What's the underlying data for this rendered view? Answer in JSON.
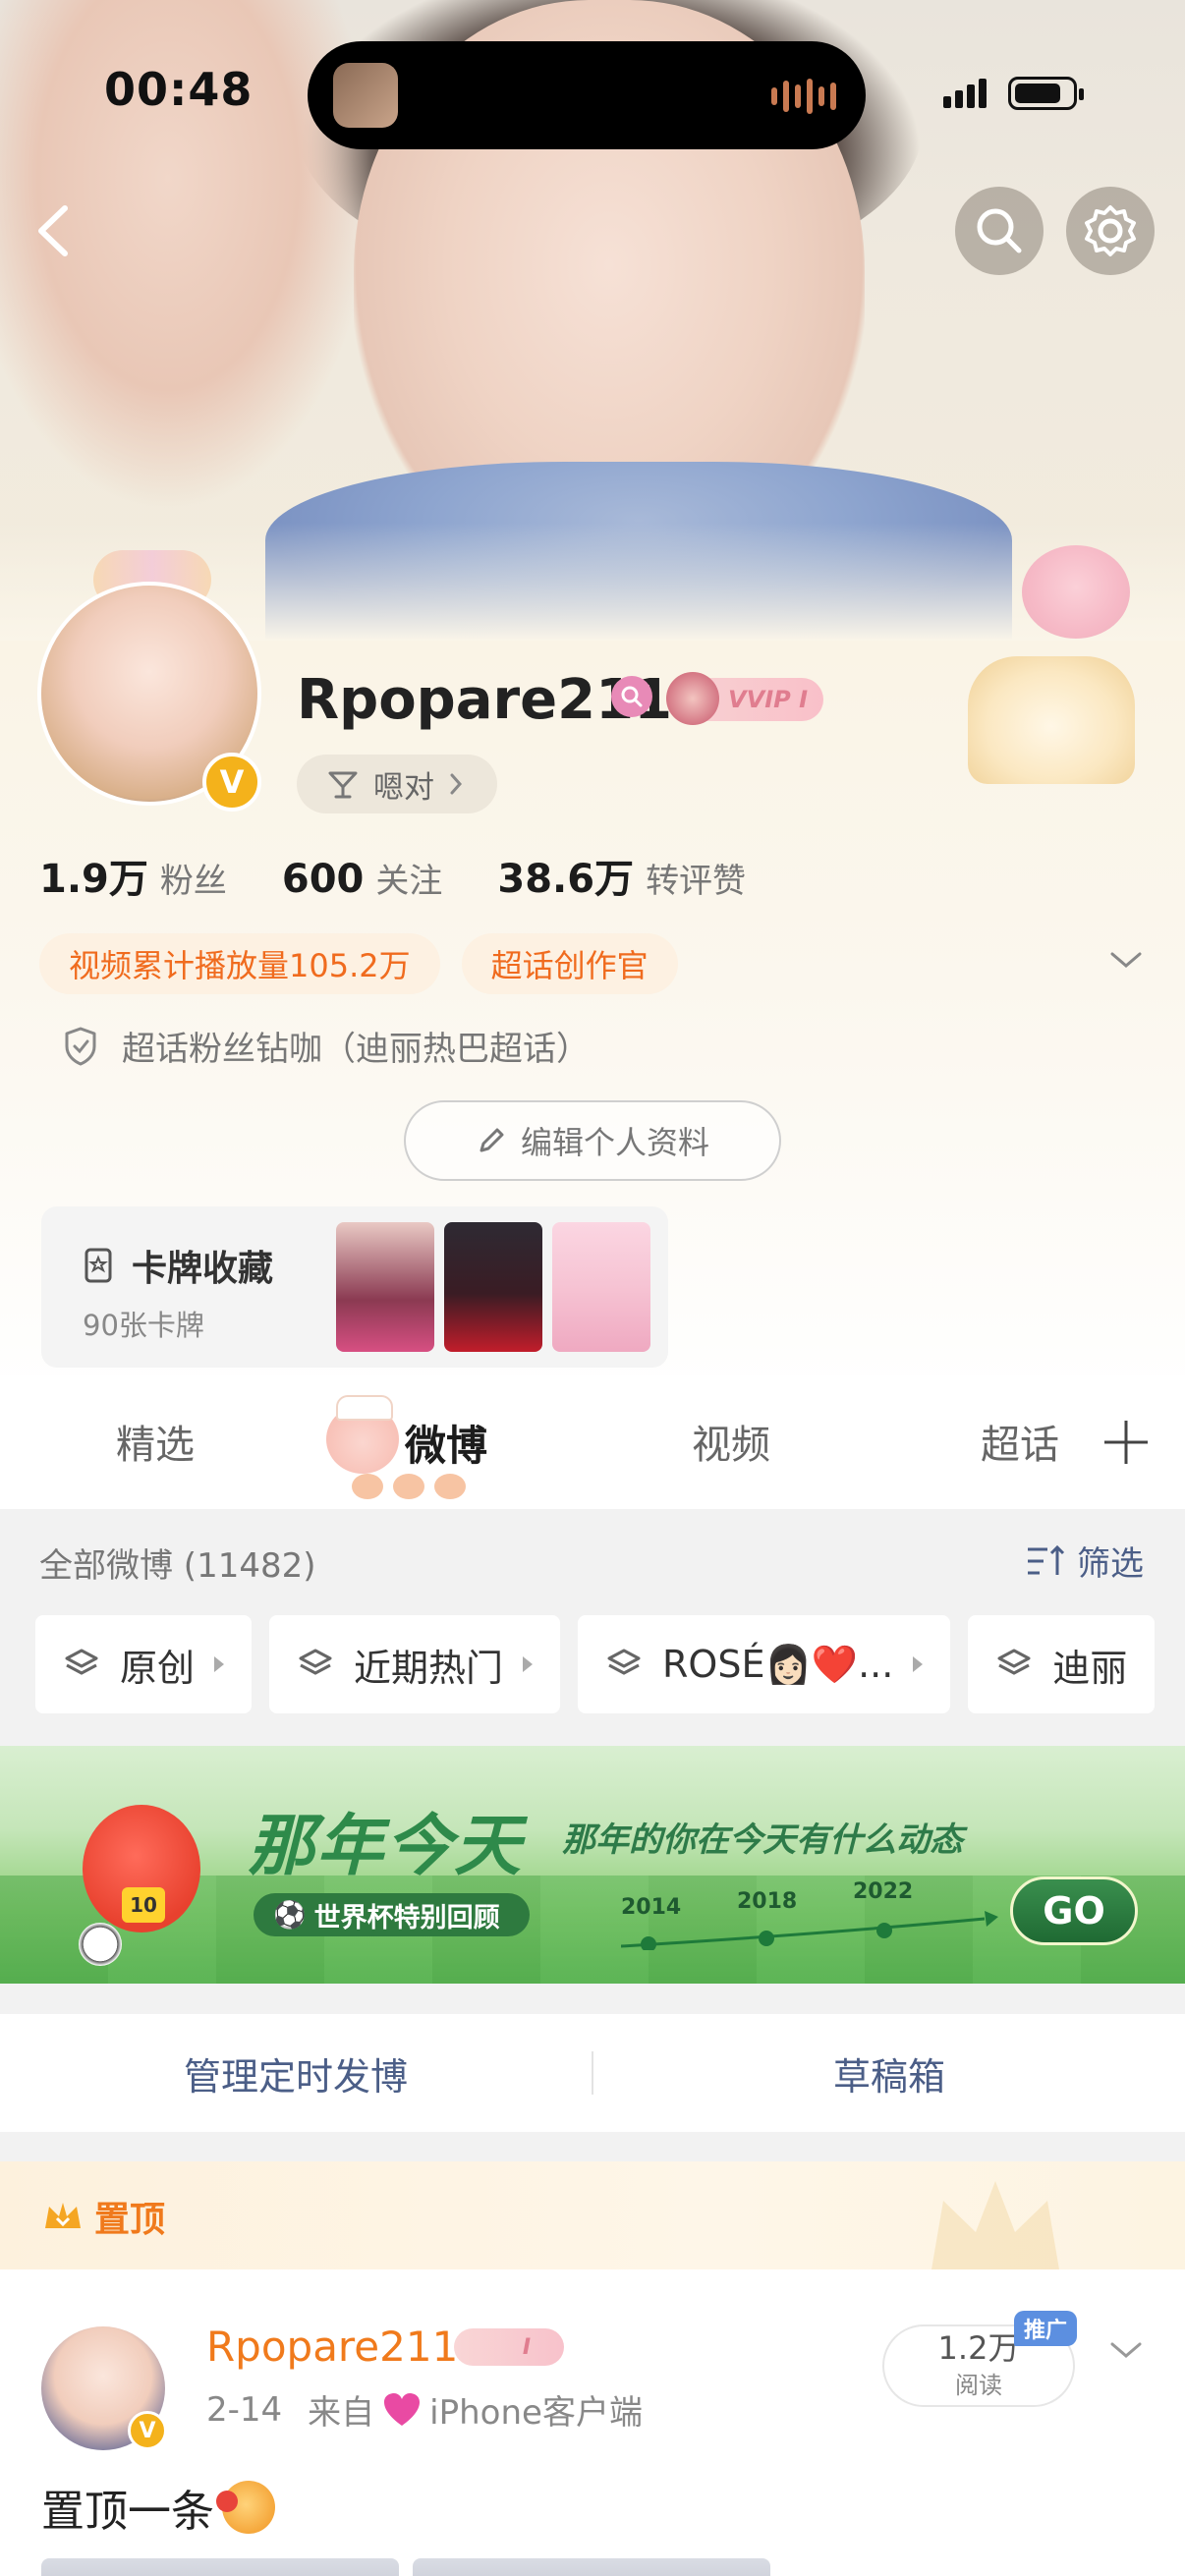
{
  "status_bar": {
    "time": "00:48"
  },
  "header": {
    "back_icon": "chevron-left-icon",
    "search_icon": "search-icon",
    "settings_icon": "gear-icon"
  },
  "profile": {
    "username": "Rpopare211",
    "verified_badge": "V",
    "vip_label": "VVIP I",
    "mood": "嗯对",
    "stats": [
      {
        "num": "1.9万",
        "label": "粉丝"
      },
      {
        "num": "600",
        "label": "关注"
      },
      {
        "num": "38.6万",
        "label": "转评赞"
      }
    ],
    "tags": [
      "视频累计播放量105.2万",
      "超话创作官"
    ],
    "fan_line": "超话粉丝钻咖（迪丽热巴超话）",
    "edit_button": "编辑个人资料",
    "card_collection": {
      "title": "卡牌收藏",
      "count": "90张卡牌"
    }
  },
  "tabs": {
    "items": [
      "精选",
      "微博",
      "视频",
      "超话"
    ],
    "active": "微博"
  },
  "feed": {
    "title": "全部微博 (11482)",
    "filter_label": "筛选",
    "chips": [
      "原创",
      "近期热门",
      "ROSÉ👩🏻❤️...",
      "迪丽"
    ]
  },
  "promo": {
    "headline": "那年今天",
    "subline": "那年的你在今天有什么动态",
    "pill": "世界杯特别回顾",
    "years": [
      "2014",
      "2018",
      "2022"
    ],
    "go": "GO",
    "jersey_number": "10"
  },
  "actions": {
    "schedule": "管理定时发博",
    "drafts": "草稿箱"
  },
  "pinned_post": {
    "pin_label": "置顶",
    "author": "Rpopare211",
    "vip_label": "I",
    "date": "2-14",
    "source_prefix": "来自",
    "source": "iPhone客户端",
    "reads_num": "1.2万",
    "reads_label": "阅读",
    "promo_tag": "推广",
    "text": "置顶一条"
  },
  "colors": {
    "accent_orange": "#f06b1e",
    "link_blue": "#4b5e87",
    "vip_pink": "#e07d8f",
    "verified_gold": "#f4b21b"
  }
}
